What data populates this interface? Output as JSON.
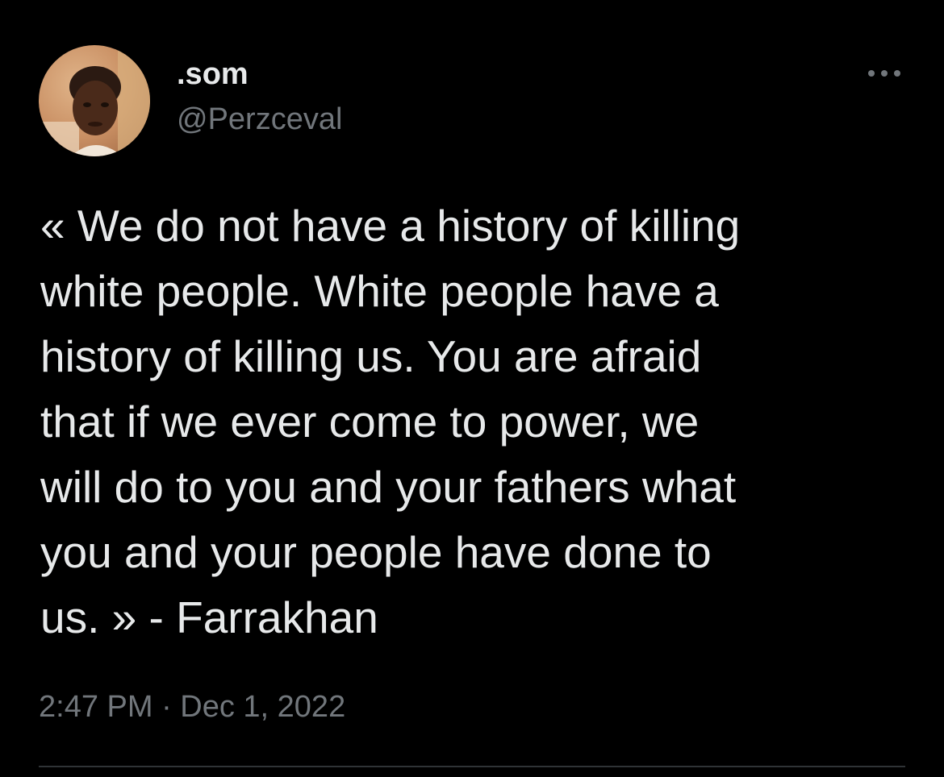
{
  "author": {
    "display_name": ".som",
    "handle": "@Perzceval"
  },
  "tweet": {
    "text_lines": [
      "« We do not have a history of killing",
      "white people. White people have a",
      "history of killing us. You are afraid",
      "that if we ever come to power, we",
      "will do to you and your fathers what",
      "you and your people have done to",
      "us. » - Farrakhan"
    ],
    "timestamp": "2:47 PM · Dec 1, 2022"
  },
  "icons": {
    "more": "more-options-icon",
    "avatar": "profile-photo"
  },
  "colors": {
    "background": "#000000",
    "primary_text": "#e7e9ea",
    "secondary_text": "#71767b",
    "divider": "#2f3336"
  }
}
